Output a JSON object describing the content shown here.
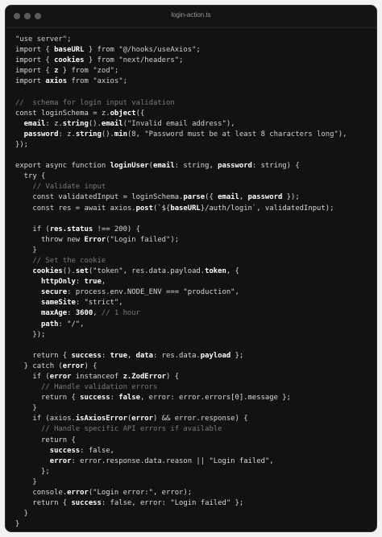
{
  "window": {
    "title": "login-action.ts"
  },
  "code_lines": [
    [
      {
        "t": "\"use server\";",
        "c": "s"
      }
    ],
    [
      {
        "t": "import { ",
        "c": "k"
      },
      {
        "t": "baseURL",
        "c": "b"
      },
      {
        "t": " } from ",
        "c": "k"
      },
      {
        "t": "\"@/hooks/useAxios\";",
        "c": "s"
      }
    ],
    [
      {
        "t": "import { ",
        "c": "k"
      },
      {
        "t": "cookies",
        "c": "b"
      },
      {
        "t": " } from ",
        "c": "k"
      },
      {
        "t": "\"next/headers\";",
        "c": "s"
      }
    ],
    [
      {
        "t": "import { ",
        "c": "k"
      },
      {
        "t": "z",
        "c": "b"
      },
      {
        "t": " } from ",
        "c": "k"
      },
      {
        "t": "\"zod\";",
        "c": "s"
      }
    ],
    [
      {
        "t": "import ",
        "c": "k"
      },
      {
        "t": "axios",
        "c": "b"
      },
      {
        "t": " from ",
        "c": "k"
      },
      {
        "t": "\"axios\";",
        "c": "s"
      }
    ],
    [],
    [
      {
        "t": "//  schema for login input validation",
        "c": "c"
      }
    ],
    [
      {
        "t": "const loginSchema = z.",
        "c": "k"
      },
      {
        "t": "object",
        "c": "b"
      },
      {
        "t": "({",
        "c": "k"
      }
    ],
    [
      {
        "t": "  email",
        "c": "b"
      },
      {
        "t": ": z.",
        "c": "k"
      },
      {
        "t": "string",
        "c": "b"
      },
      {
        "t": "().",
        "c": "k"
      },
      {
        "t": "email",
        "c": "b"
      },
      {
        "t": "(\"Invalid email address\"),",
        "c": "s"
      }
    ],
    [
      {
        "t": "  password",
        "c": "b"
      },
      {
        "t": ": z.",
        "c": "k"
      },
      {
        "t": "string",
        "c": "b"
      },
      {
        "t": "().",
        "c": "k"
      },
      {
        "t": "min",
        "c": "b"
      },
      {
        "t": "(8, \"Password must be at least 8 characters long\"),",
        "c": "s"
      }
    ],
    [
      {
        "t": "});",
        "c": "k"
      }
    ],
    [],
    [
      {
        "t": "export async function ",
        "c": "k"
      },
      {
        "t": "loginUser",
        "c": "b"
      },
      {
        "t": "(",
        "c": "k"
      },
      {
        "t": "email",
        "c": "b"
      },
      {
        "t": ": string, ",
        "c": "k"
      },
      {
        "t": "password",
        "c": "b"
      },
      {
        "t": ": string) {",
        "c": "k"
      }
    ],
    [
      {
        "t": "  try {",
        "c": "k"
      }
    ],
    [
      {
        "t": "    // Validate input",
        "c": "c"
      }
    ],
    [
      {
        "t": "    const validatedInput = loginSchema.",
        "c": "k"
      },
      {
        "t": "parse",
        "c": "b"
      },
      {
        "t": "({ ",
        "c": "k"
      },
      {
        "t": "email",
        "c": "b"
      },
      {
        "t": ", ",
        "c": "k"
      },
      {
        "t": "password",
        "c": "b"
      },
      {
        "t": " });",
        "c": "k"
      }
    ],
    [
      {
        "t": "    const res = await axios.",
        "c": "k"
      },
      {
        "t": "post",
        "c": "b"
      },
      {
        "t": "(`${",
        "c": "k"
      },
      {
        "t": "baseURL",
        "c": "b"
      },
      {
        "t": "}/auth/login`, validatedInput);",
        "c": "k"
      }
    ],
    [],
    [
      {
        "t": "    if (",
        "c": "k"
      },
      {
        "t": "res.status",
        "c": "b"
      },
      {
        "t": " !== 200) {",
        "c": "k"
      }
    ],
    [
      {
        "t": "      throw new ",
        "c": "k"
      },
      {
        "t": "Error",
        "c": "b"
      },
      {
        "t": "(\"Login failed\");",
        "c": "s"
      }
    ],
    [
      {
        "t": "    }",
        "c": "k"
      }
    ],
    [
      {
        "t": "    // Set the cookie",
        "c": "c"
      }
    ],
    [
      {
        "t": "    cookies",
        "c": "b"
      },
      {
        "t": "().",
        "c": "k"
      },
      {
        "t": "set",
        "c": "b"
      },
      {
        "t": "(\"token\", res.data.payload.",
        "c": "k"
      },
      {
        "t": "token",
        "c": "b"
      },
      {
        "t": ", {",
        "c": "k"
      }
    ],
    [
      {
        "t": "      httpOnly",
        "c": "b"
      },
      {
        "t": ": ",
        "c": "k"
      },
      {
        "t": "true",
        "c": "b"
      },
      {
        "t": ",",
        "c": "k"
      }
    ],
    [
      {
        "t": "      secure",
        "c": "b"
      },
      {
        "t": ": process.env.NODE_ENV === \"production\",",
        "c": "k"
      }
    ],
    [
      {
        "t": "      sameSite",
        "c": "b"
      },
      {
        "t": ": \"strict\",",
        "c": "k"
      }
    ],
    [
      {
        "t": "      maxAge",
        "c": "b"
      },
      {
        "t": ": ",
        "c": "k"
      },
      {
        "t": "3600",
        "c": "b"
      },
      {
        "t": ", ",
        "c": "k"
      },
      {
        "t": "// 1 hour",
        "c": "c"
      }
    ],
    [
      {
        "t": "      path",
        "c": "b"
      },
      {
        "t": ": \"/\",",
        "c": "k"
      }
    ],
    [
      {
        "t": "    });",
        "c": "k"
      }
    ],
    [],
    [
      {
        "t": "    return { ",
        "c": "k"
      },
      {
        "t": "success",
        "c": "b"
      },
      {
        "t": ": ",
        "c": "k"
      },
      {
        "t": "true",
        "c": "b"
      },
      {
        "t": ", ",
        "c": "k"
      },
      {
        "t": "data",
        "c": "b"
      },
      {
        "t": ": res.data.",
        "c": "k"
      },
      {
        "t": "payload",
        "c": "b"
      },
      {
        "t": " };",
        "c": "k"
      }
    ],
    [
      {
        "t": "  } catch (",
        "c": "k"
      },
      {
        "t": "error",
        "c": "b"
      },
      {
        "t": ") {",
        "c": "k"
      }
    ],
    [
      {
        "t": "    if (",
        "c": "k"
      },
      {
        "t": "error",
        "c": "b"
      },
      {
        "t": " instanceof ",
        "c": "k"
      },
      {
        "t": "z.ZodError",
        "c": "b"
      },
      {
        "t": ") {",
        "c": "k"
      }
    ],
    [
      {
        "t": "      // Handle validation errors",
        "c": "c"
      }
    ],
    [
      {
        "t": "      return { ",
        "c": "k"
      },
      {
        "t": "success",
        "c": "b"
      },
      {
        "t": ": ",
        "c": "k"
      },
      {
        "t": "false",
        "c": "b"
      },
      {
        "t": ", error: error.errors[0].message };",
        "c": "k"
      }
    ],
    [
      {
        "t": "    }",
        "c": "k"
      }
    ],
    [
      {
        "t": "    if (axios.",
        "c": "k"
      },
      {
        "t": "isAxiosError",
        "c": "b"
      },
      {
        "t": "(",
        "c": "k"
      },
      {
        "t": "error",
        "c": "b"
      },
      {
        "t": ") && error.response) {",
        "c": "k"
      }
    ],
    [
      {
        "t": "      // Handle specific API errors if available",
        "c": "c"
      }
    ],
    [
      {
        "t": "      return {",
        "c": "k"
      }
    ],
    [
      {
        "t": "        success",
        "c": "b"
      },
      {
        "t": ": false,",
        "c": "k"
      }
    ],
    [
      {
        "t": "        error",
        "c": "b"
      },
      {
        "t": ": error.response.data.reason || \"Login failed\",",
        "c": "k"
      }
    ],
    [
      {
        "t": "      };",
        "c": "k"
      }
    ],
    [
      {
        "t": "    }",
        "c": "k"
      }
    ],
    [
      {
        "t": "    console.",
        "c": "k"
      },
      {
        "t": "error",
        "c": "b"
      },
      {
        "t": "(\"Login error:\", error);",
        "c": "k"
      }
    ],
    [
      {
        "t": "    return { ",
        "c": "k"
      },
      {
        "t": "success",
        "c": "b"
      },
      {
        "t": ": false, error: \"Login failed\" };",
        "c": "k"
      }
    ],
    [
      {
        "t": "  }",
        "c": "k"
      }
    ],
    [
      {
        "t": "}",
        "c": "k"
      }
    ]
  ]
}
